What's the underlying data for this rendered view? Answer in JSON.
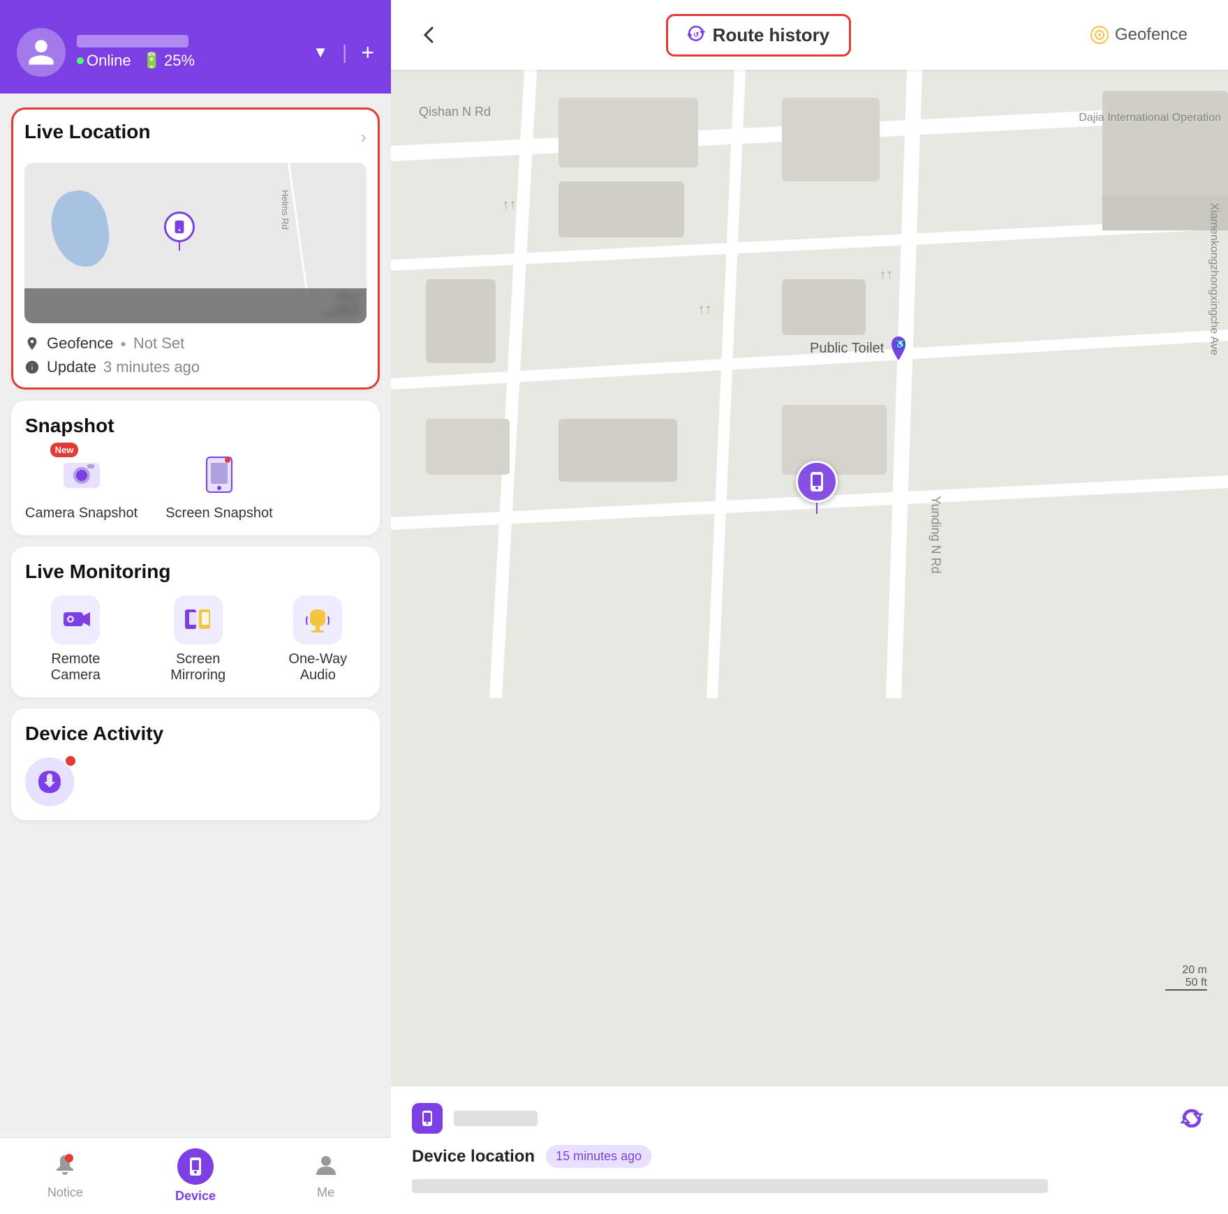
{
  "header": {
    "avatar_alt": "user-avatar",
    "online_label": "Online",
    "battery_pct": "25%",
    "dropdown_icon": "▼",
    "add_icon": "+"
  },
  "live_location": {
    "title": "Live Location",
    "geofence_label": "Geofence",
    "geofence_value": "Not Set",
    "update_label": "Update",
    "update_value": "3 minutes ago",
    "scale_50m": "50 m",
    "scale_100ft": "100 ft",
    "road_label": "Helms Rd"
  },
  "snapshot": {
    "title": "Snapshot",
    "camera_new_badge": "New",
    "camera_label": "Camera Snapshot",
    "screen_label": "Screen Snapshot"
  },
  "live_monitoring": {
    "title": "Live Monitoring",
    "remote_camera": "Remote Camera",
    "screen_mirroring": "Screen Mirroring",
    "one_way_audio": "One-Way Audio"
  },
  "device_activity": {
    "title": "Device Activity"
  },
  "bottom_nav": {
    "notice": "Notice",
    "device": "Device",
    "me": "Me"
  },
  "right_panel": {
    "back_icon": "←",
    "route_history_label": "Route history",
    "geofence_label": "Geofence",
    "street_labels": [
      "Qishan N Rd",
      "Yunding N Rd",
      "Xiamenkongzhongxingche Ave",
      "Dajia International Operation"
    ],
    "poi_label": "Public Toilet",
    "scale_20m": "20 m",
    "scale_50ft": "50 ft",
    "device_location_label": "Device location",
    "time_ago": "15 minutes ago"
  }
}
